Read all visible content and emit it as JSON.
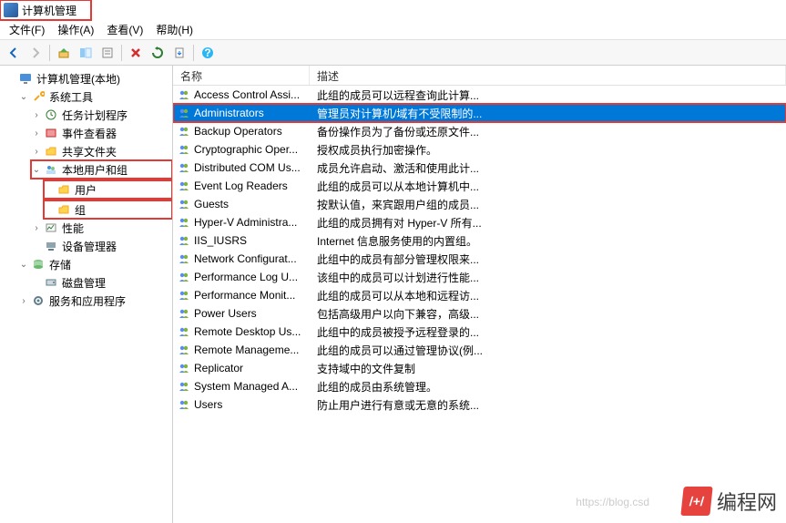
{
  "window": {
    "title": "计算机管理"
  },
  "menu": {
    "file": "文件(F)",
    "action": "操作(A)",
    "view": "查看(V)",
    "help": "帮助(H)"
  },
  "toolbar_icons": {
    "back": "back-arrow",
    "forward": "forward-arrow",
    "up": "up",
    "show_hide": "show-hide",
    "properties": "properties",
    "delete": "delete",
    "refresh": "refresh",
    "export": "export",
    "help": "help"
  },
  "tree": {
    "root": {
      "label": "计算机管理(本地)"
    },
    "system_tools": {
      "label": "系统工具"
    },
    "task_scheduler": {
      "label": "任务计划程序"
    },
    "event_viewer": {
      "label": "事件查看器"
    },
    "shared_folders": {
      "label": "共享文件夹"
    },
    "local_users_groups": {
      "label": "本地用户和组"
    },
    "users": {
      "label": "用户"
    },
    "groups": {
      "label": "组"
    },
    "performance": {
      "label": "性能"
    },
    "device_manager": {
      "label": "设备管理器"
    },
    "storage": {
      "label": "存储"
    },
    "disk_mgmt": {
      "label": "磁盘管理"
    },
    "services_apps": {
      "label": "服务和应用程序"
    }
  },
  "list": {
    "col_name": "名称",
    "col_desc": "描述",
    "rows": [
      {
        "name": "Access Control Assi...",
        "desc": "此组的成员可以远程查询此计算..."
      },
      {
        "name": "Administrators",
        "desc": "管理员对计算机/域有不受限制的...",
        "selected": true
      },
      {
        "name": "Backup Operators",
        "desc": "备份操作员为了备份或还原文件..."
      },
      {
        "name": "Cryptographic Oper...",
        "desc": "授权成员执行加密操作。"
      },
      {
        "name": "Distributed COM Us...",
        "desc": "成员允许启动、激活和使用此计..."
      },
      {
        "name": "Event Log Readers",
        "desc": "此组的成员可以从本地计算机中..."
      },
      {
        "name": "Guests",
        "desc": "按默认值，来宾跟用户组的成员..."
      },
      {
        "name": "Hyper-V Administra...",
        "desc": "此组的成员拥有对 Hyper-V 所有..."
      },
      {
        "name": "IIS_IUSRS",
        "desc": "Internet 信息服务使用的内置组。"
      },
      {
        "name": "Network Configurat...",
        "desc": "此组中的成员有部分管理权限来..."
      },
      {
        "name": "Performance Log U...",
        "desc": "该组中的成员可以计划进行性能..."
      },
      {
        "name": "Performance Monit...",
        "desc": "此组的成员可以从本地和远程访..."
      },
      {
        "name": "Power Users",
        "desc": "包括高级用户以向下兼容，高级..."
      },
      {
        "name": "Remote Desktop Us...",
        "desc": "此组中的成员被授予远程登录的..."
      },
      {
        "name": "Remote Manageme...",
        "desc": "此组的成员可以通过管理协议(例..."
      },
      {
        "name": "Replicator",
        "desc": "支持域中的文件复制"
      },
      {
        "name": "System Managed A...",
        "desc": "此组的成员由系统管理。"
      },
      {
        "name": "Users",
        "desc": "防止用户进行有意或无意的系统..."
      }
    ]
  },
  "watermark": {
    "logo": "/+/",
    "text": "编程网",
    "url": "https://blog.csd"
  }
}
